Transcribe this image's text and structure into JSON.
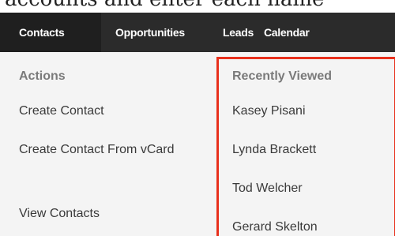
{
  "caption": "accounts and enter each name",
  "nav": {
    "tabs": [
      "Contacts",
      "Opportunities",
      "Leads",
      "Calendar"
    ]
  },
  "menu": {
    "actions_heading": "Actions",
    "actions": [
      "Create Contact",
      "Create Contact From vCard",
      "View Contacts"
    ],
    "recent_heading": "Recently Viewed",
    "recent": [
      "Kasey Pisani",
      "Lynda Brackett",
      "Tod Welcher",
      "Gerard Skelton"
    ]
  },
  "colors": {
    "navbar": "#2b2b2b",
    "highlight_border": "#e8301c"
  }
}
